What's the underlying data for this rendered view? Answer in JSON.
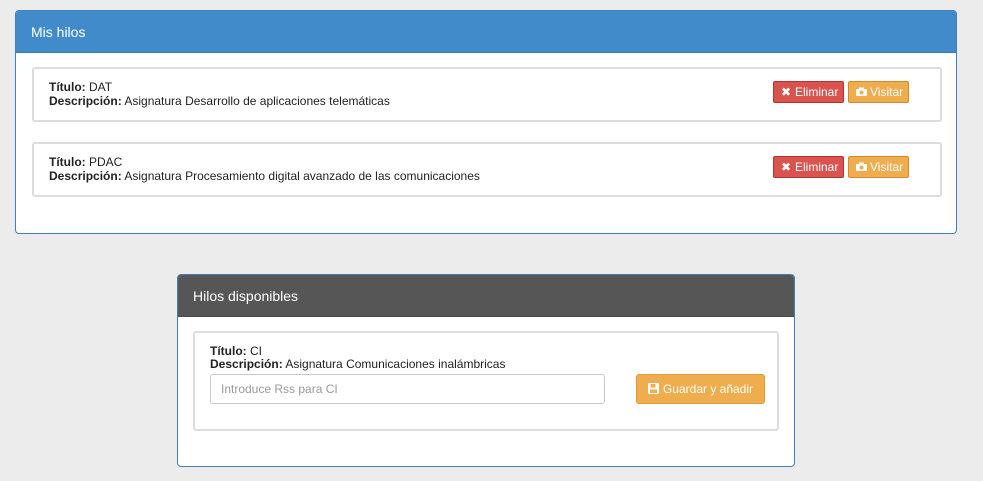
{
  "my_threads": {
    "title": "Mis hilos",
    "items": [
      {
        "title_label": "Título:",
        "title_value": "DAT",
        "desc_label": "Descripción:",
        "desc_value": "Asignatura Desarrollo de aplicaciones telemáticas",
        "delete_label": "Eliminar",
        "visit_label": "Visitar"
      },
      {
        "title_label": "Título:",
        "title_value": "PDAC",
        "desc_label": "Descripción:",
        "desc_value": "Asignatura Procesamiento digital avanzado de las comunicaciones",
        "delete_label": "Eliminar",
        "visit_label": "Visitar"
      }
    ]
  },
  "available_threads": {
    "title": "Hilos disponibles",
    "items": [
      {
        "title_label": "Título:",
        "title_value": "CI",
        "desc_label": "Descripción:",
        "desc_value": "Asignatura Comunicaciones inalámbricas",
        "rss_placeholder": "Introduce Rss para CI",
        "save_label": "Guardar y añadir"
      }
    ]
  },
  "icons": {
    "delete": "times-icon",
    "visit": "camera-icon",
    "save": "floppy-icon"
  },
  "colors": {
    "primary_header": "#428bca",
    "dark_header": "#565656",
    "danger": "#d9534f",
    "warning": "#f0ad4e"
  }
}
